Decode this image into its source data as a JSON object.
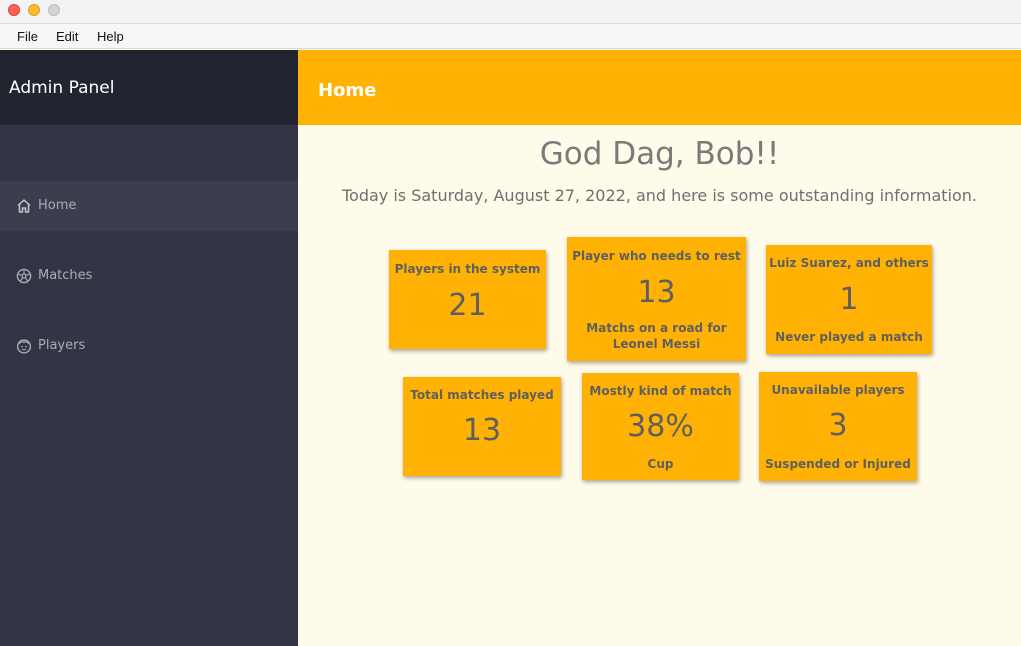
{
  "window": {
    "menu": [
      "File",
      "Edit",
      "Help"
    ]
  },
  "sidebar": {
    "title": "Admin Panel",
    "items": [
      {
        "label": "Home",
        "icon": "home-icon"
      },
      {
        "label": "Matches",
        "icon": "soccer-ball-icon"
      },
      {
        "label": "Players",
        "icon": "player-face-icon"
      }
    ]
  },
  "header": {
    "title": "Home"
  },
  "main": {
    "greeting": "God Dag, Bob!!",
    "info": "Today is Saturday, August 27, 2022, and here is some outstanding information."
  },
  "cards": [
    {
      "title": "Players in the system",
      "value": "21",
      "sub": ""
    },
    {
      "title": "Player who needs to rest",
      "value": "13",
      "sub": "Matchs on a road for Leonel Messi"
    },
    {
      "title": "Luiz Suarez, and others",
      "value": "1",
      "sub": "Never played a match"
    },
    {
      "title": "Total matches played",
      "value": "13",
      "sub": ""
    },
    {
      "title": "Mostly kind of match",
      "value": "38%",
      "sub": "Cup"
    },
    {
      "title": "Unavailable players",
      "value": "3",
      "sub": "Suspended or Injured"
    }
  ],
  "colors": {
    "accent": "#ffb203",
    "sidebar": "#323544",
    "sidebar_header": "#22252f",
    "background": "#fffbea"
  }
}
